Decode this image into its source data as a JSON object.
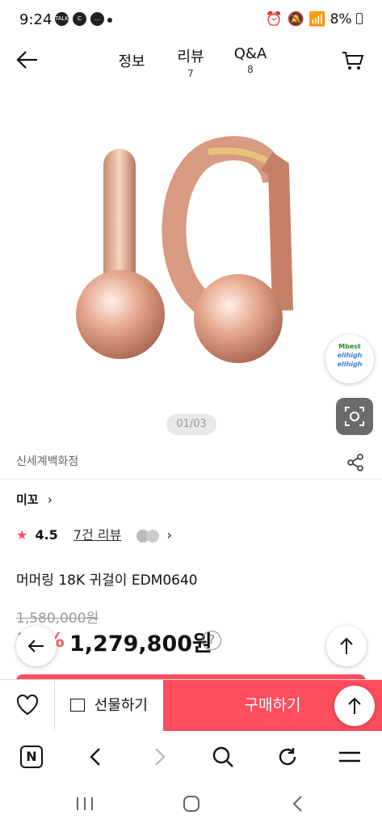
{
  "status_bar": {
    "time": "9:24",
    "battery": "8%",
    "app_icons": [
      "talk-icon",
      "c-icon",
      "chat-icon"
    ]
  },
  "header": {
    "tabs": [
      {
        "label": "정보",
        "count": ""
      },
      {
        "label": "리뷰",
        "count": "7"
      },
      {
        "label": "Q&A",
        "count": "8"
      }
    ]
  },
  "gallery": {
    "pager": "01/03",
    "badge_lines": [
      "Mbest",
      "elihigh",
      "elihigh"
    ]
  },
  "product": {
    "store": "신세계백화점",
    "brand": "미꼬",
    "rating": "4.5",
    "reviews_link": "7건 리뷰",
    "name": "머머링 18K 귀걸이 EDM0640",
    "original_price": "1,580,000원",
    "discount": "19%",
    "price": "1,279,800원"
  },
  "buy_bar": {
    "gift_label": "선물하기",
    "buy_label": "구매하기"
  },
  "colors": {
    "accent": "#ff4d5e",
    "discount": "#ff5b5b"
  }
}
